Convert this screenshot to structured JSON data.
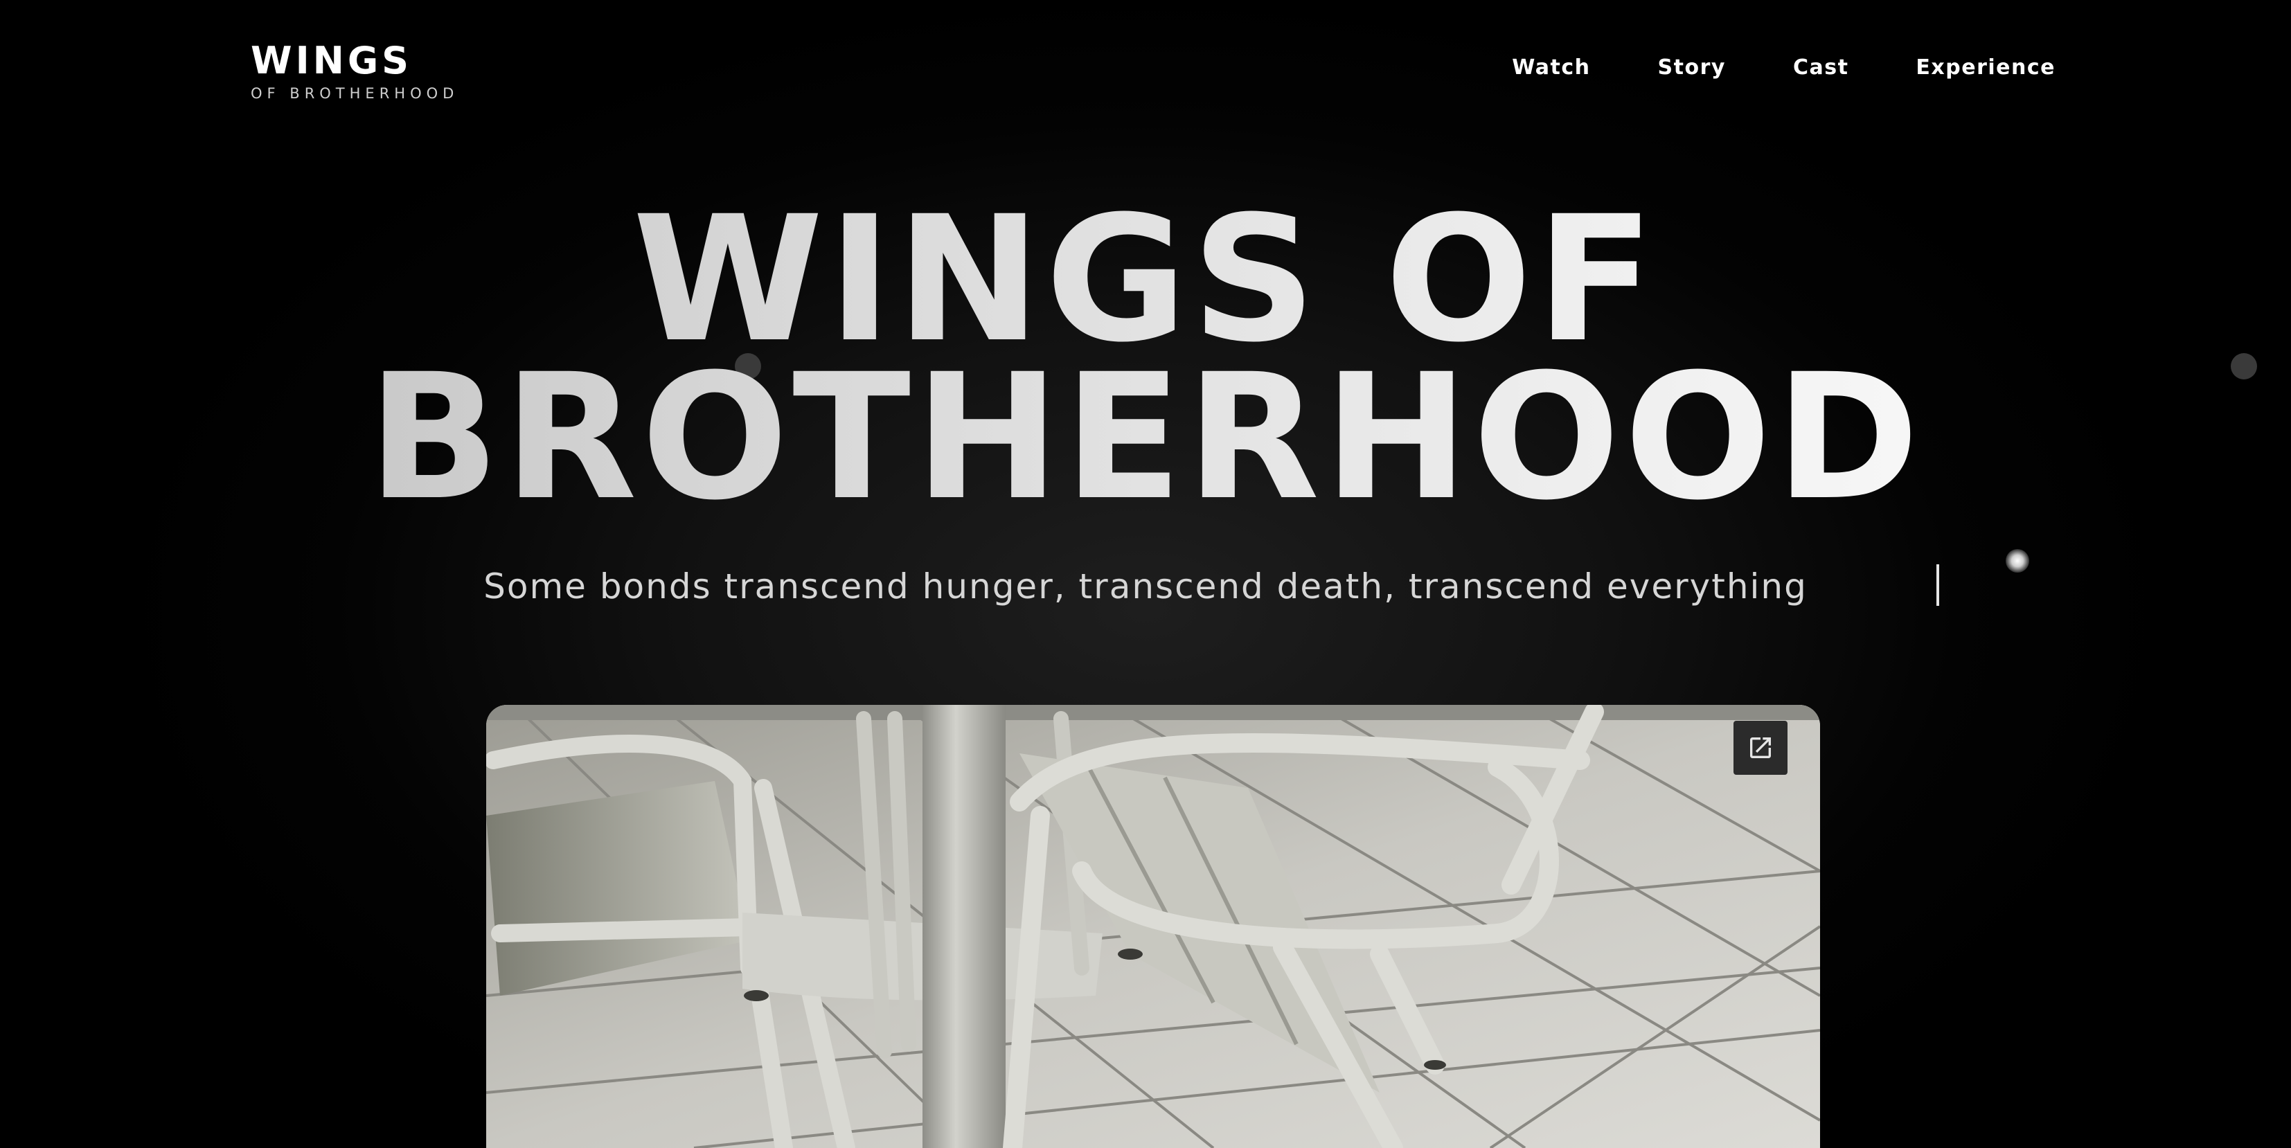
{
  "header": {
    "logo_main": "WINGS",
    "logo_sub": "OF BROTHERHOOD",
    "nav": [
      {
        "label": "Watch"
      },
      {
        "label": "Story"
      },
      {
        "label": "Cast"
      },
      {
        "label": "Experience"
      }
    ]
  },
  "hero": {
    "title_line1": "WINGS  OF",
    "title_line2": "BROTHERHOOD",
    "subtitle": "Some bonds transcend hunger, transcend death, transcend everything"
  },
  "media": {
    "open_icon": "external-link-icon"
  },
  "colors": {
    "background": "#000000",
    "text": "#ffffff",
    "subtitle": "#d6d6d6"
  }
}
